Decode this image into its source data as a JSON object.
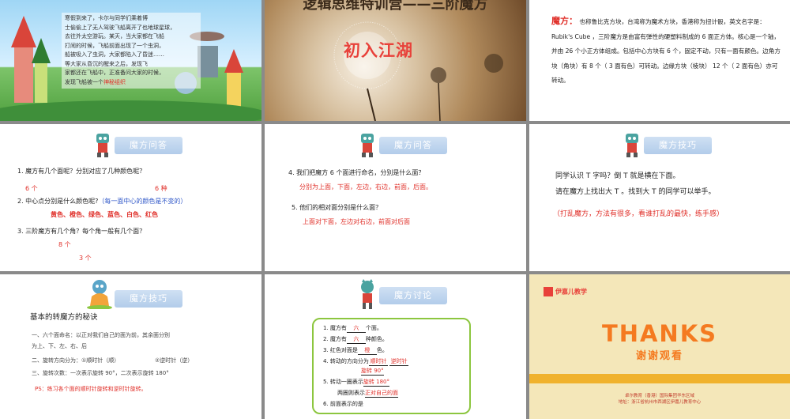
{
  "slide1": {
    "story_lines": [
      "寒假到来了，卡尔与同学们乘着博",
      "士偷偷上了无人驾驶飞船离开了也地球星球，",
      "去往外太空游玩。某天，当大家都在飞船",
      "打闹的时候，飞船前面出现了一个虫洞，",
      "船被吸入了虫洞，大家都陷入了昏迷……",
      "等大家从昏沉的醒来之后，发现飞",
      "家都还在飞船中，正准备问大家的时候，",
      "发现飞船被一个"
    ],
    "story_highlight": "神秘组织"
  },
  "slide2": {
    "title": "逻辑思维特训营——三阶魔方",
    "subtitle": "初入江湖"
  },
  "slide3": {
    "term": "魔方：",
    "text": "也称鲁比克方块，台湾称为魔术方块，香港称为扭计骰，英文名字是： Rubik's Cube ，三阶魔方是由富有弹性的硬塑料制成的 6 面正方体。核心是一个轴，并由 26 个小正方体组成。包括中心方块有 6 个，固定不动，只有一面有颜色。边角方块（角块）有 8 个（ 3 面有色）可转动。边缘方块（棱块） 12 个（ 2 面有色）亦可转动。"
  },
  "slide4": {
    "badge": "魔方问答",
    "q1": "1.  魔方有几个面呢？分别对应了几种颜色呢？",
    "a1a": "6 个",
    "a1b": "6 种",
    "q2": "2.  中心点分别是什么颜色呢?",
    "q2_note": "（每一面中心的颜色是不变的）",
    "a2": "黄色、橙色、绿色、蓝色、白色、红色",
    "q3": "3.  三阶魔方有几个角？每个角一般有几个面？",
    "a3a": "8 个",
    "a3b": "3 个"
  },
  "slide5": {
    "badge": "魔方问答",
    "q4": "4.  我们把魔方 6 个面进行命名，分别是什么面？",
    "a4": "分别为上面，下面，左边，右边，前面，后面。",
    "q5": "5.  他们的相对面分别是什么面？",
    "a5": "上面对下面，左边对右边，前面对后面"
  },
  "slide6": {
    "badge": "魔方技巧",
    "line1": "同学认识 T 字吗？倒 T 就是横在下面。",
    "line2": "请在魔方上找出大 T 。找到大 T 的同学可以举手。",
    "line3": "（打乱魔方，方法有很多，看谁打乱的最快，练手感）"
  },
  "slide7": {
    "badge": "魔方技巧",
    "heading": "基本的转魔方的秘诀",
    "l1": "一、六个面命名：以正对我们自己的面为前，其余面分别",
    "l1b": "为上、下、左、右、后",
    "l2a": "二、旋转方向分为：①顺时针（顺）",
    "l2b": "②逆时针（逆）",
    "l3": "三、旋转次数：一次表示旋转 90°，二次表示旋转 180°",
    "ps": "PS：练习各个面的顺时针旋转和逆时针旋转。"
  },
  "slide8": {
    "badge": "魔方讨论",
    "r1_pre": "1.  魔方有",
    "r1_ans": "六",
    "r1_post": "个面。",
    "r2_pre": "2.  魔方有",
    "r2_ans": "六",
    "r2_post": "种颜色。",
    "r3_pre": "3.  红色对面是",
    "r3_ans": "橙",
    "r3_post": "色。",
    "r4_pre": "4.  转动的方向分为",
    "r4_ans1": "顺时针",
    "r4_ans2": "逆时针",
    "r4b_ans": "旋转 90°",
    "r5_pre": "5.  转动一圈表示",
    "r5_ans": "旋转 180°",
    "r5b_pre": "两圈则表示",
    "r5b_ans": "正对自己的面",
    "r6": "6.  前面表示的是"
  },
  "slide9": {
    "logo": "伊嘉儿教学",
    "thanks": "THANKS",
    "thanks_cn": "谢谢观看",
    "foot1": "卓尔教育（香港）国际集团华东区域",
    "foot2": "地址：浙江省杭州市西湖区伊嘉儿教育中心"
  }
}
